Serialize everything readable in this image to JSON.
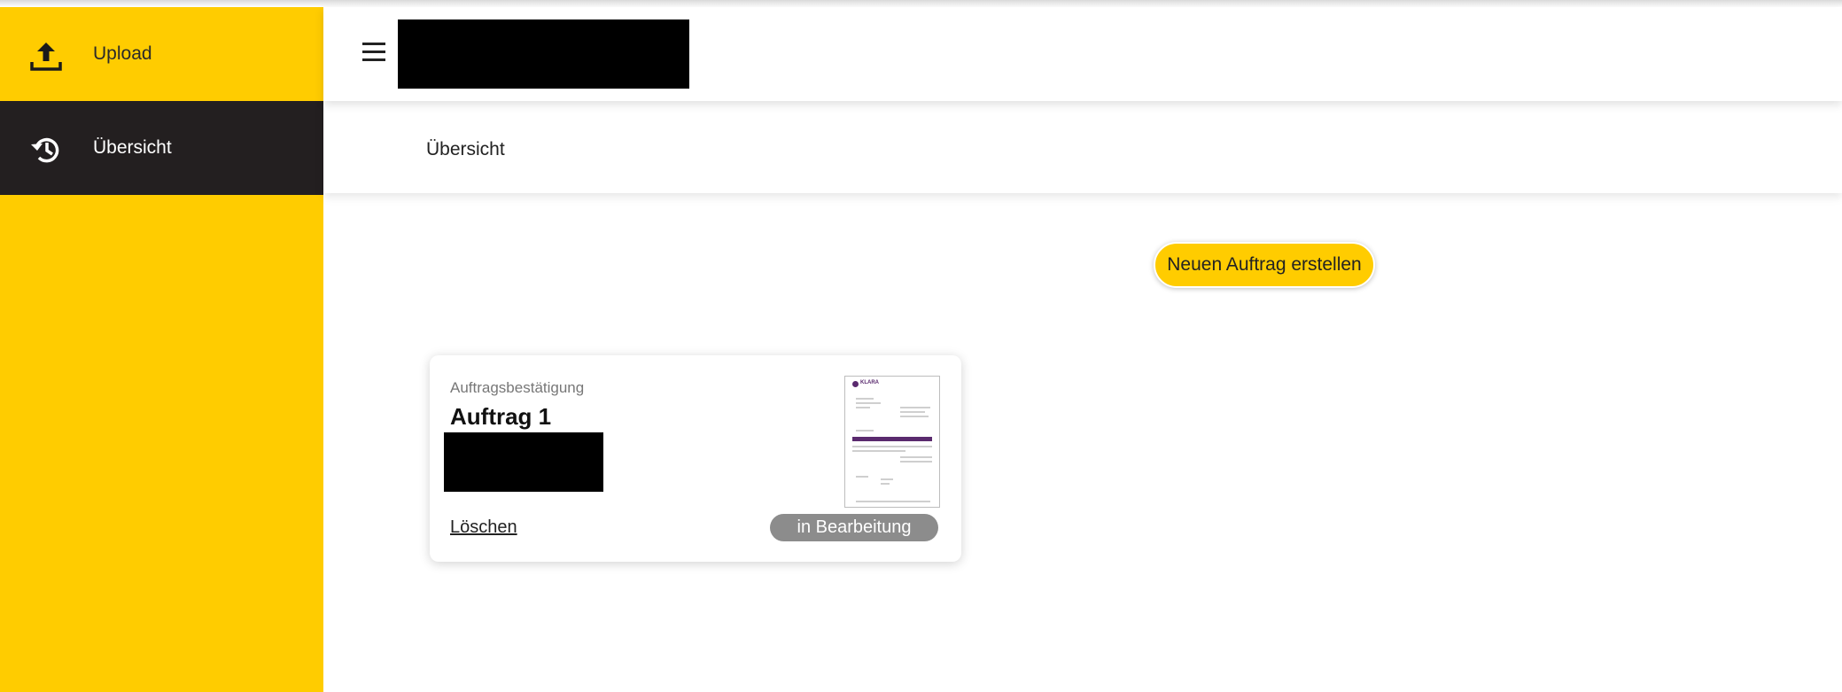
{
  "sidebar": {
    "items": [
      {
        "label": "Upload",
        "icon": "upload-icon",
        "active": false
      },
      {
        "label": "Übersicht",
        "icon": "history-icon",
        "active": true
      }
    ]
  },
  "header": {
    "menu_icon": "hamburger-menu-icon"
  },
  "subheader": {
    "title": "Übersicht"
  },
  "main": {
    "new_order_label": "Neuen Auftrag erstellen",
    "cards": [
      {
        "type": "Auftragsbestätigung",
        "title": "Auftrag 1",
        "delete_label": "Löschen",
        "status": "in Bearbeitung",
        "thumbnail_logo": "KLARA"
      }
    ]
  },
  "colors": {
    "accent": "#ffcc00",
    "sidebar_active_bg": "#231f20",
    "status_badge": "#8c8c8c",
    "thumbnail_brand": "#5a2a6e"
  }
}
